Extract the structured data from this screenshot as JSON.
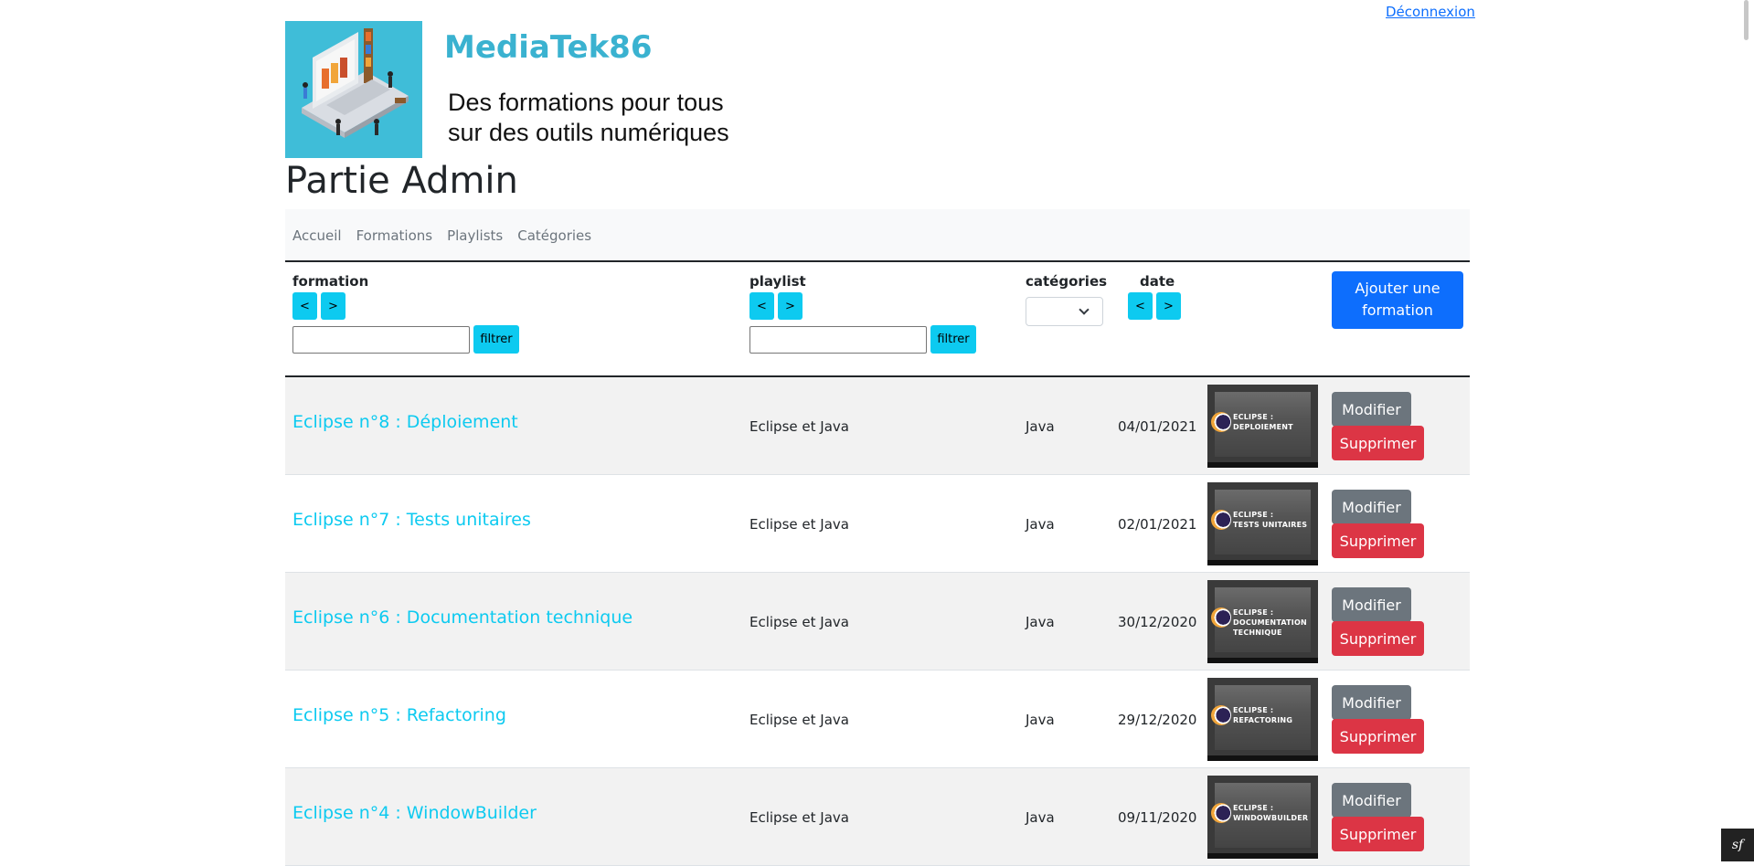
{
  "header": {
    "logout": "Déconnexion",
    "brand": "MediaTek86",
    "tagline_line1": "Des formations pour tous",
    "tagline_line2": "sur des outils numériques",
    "page_title": "Partie Admin"
  },
  "nav": {
    "items": [
      {
        "label": "Accueil"
      },
      {
        "label": "Formations"
      },
      {
        "label": "Playlists"
      },
      {
        "label": "Catégories"
      }
    ]
  },
  "table": {
    "headers": {
      "formation": "formation",
      "playlist": "playlist",
      "categories": "catégories",
      "date": "date"
    },
    "sort_prev": "<",
    "sort_next": ">",
    "filter_label": "filtrer",
    "filter_formation_value": "",
    "filter_playlist_value": "",
    "categories_selected": "",
    "add_button": "Ajouter une formation",
    "rows": [
      {
        "title": "Eclipse n°8 : Déploiement",
        "playlist": "Eclipse et Java",
        "category": "Java",
        "date": "04/01/2021",
        "thumb_caption_1": "ECLIPSE :",
        "thumb_caption_2": "DEPLOIEMENT",
        "thumb_caption_3": ""
      },
      {
        "title": "Eclipse n°7 : Tests unitaires",
        "playlist": "Eclipse et Java",
        "category": "Java",
        "date": "02/01/2021",
        "thumb_caption_1": "ECLIPSE :",
        "thumb_caption_2": "TESTS UNITAIRES",
        "thumb_caption_3": ""
      },
      {
        "title": "Eclipse n°6 : Documentation technique",
        "playlist": "Eclipse et Java",
        "category": "Java",
        "date": "30/12/2020",
        "thumb_caption_1": "ECLIPSE :",
        "thumb_caption_2": "DOCUMENTATION",
        "thumb_caption_3": "TECHNIQUE"
      },
      {
        "title": "Eclipse n°5 : Refactoring",
        "playlist": "Eclipse et Java",
        "category": "Java",
        "date": "29/12/2020",
        "thumb_caption_1": "ECLIPSE :",
        "thumb_caption_2": "REFACTORING",
        "thumb_caption_3": ""
      },
      {
        "title": "Eclipse n°4 : WindowBuilder",
        "playlist": "Eclipse et Java",
        "category": "Java",
        "date": "09/11/2020",
        "thumb_caption_1": "ECLIPSE :",
        "thumb_caption_2": "WINDOWBUILDER",
        "thumb_caption_3": ""
      }
    ],
    "edit_label": "Modifier",
    "delete_label": "Supprimer"
  },
  "colors": {
    "accent": "#0dcaf0",
    "primary": "#0d6efd",
    "danger": "#dc3545",
    "secondary": "#6c757d",
    "brand": "#3ab2d0"
  },
  "icons": {
    "symfony_toolbar": "symfony-icon"
  }
}
